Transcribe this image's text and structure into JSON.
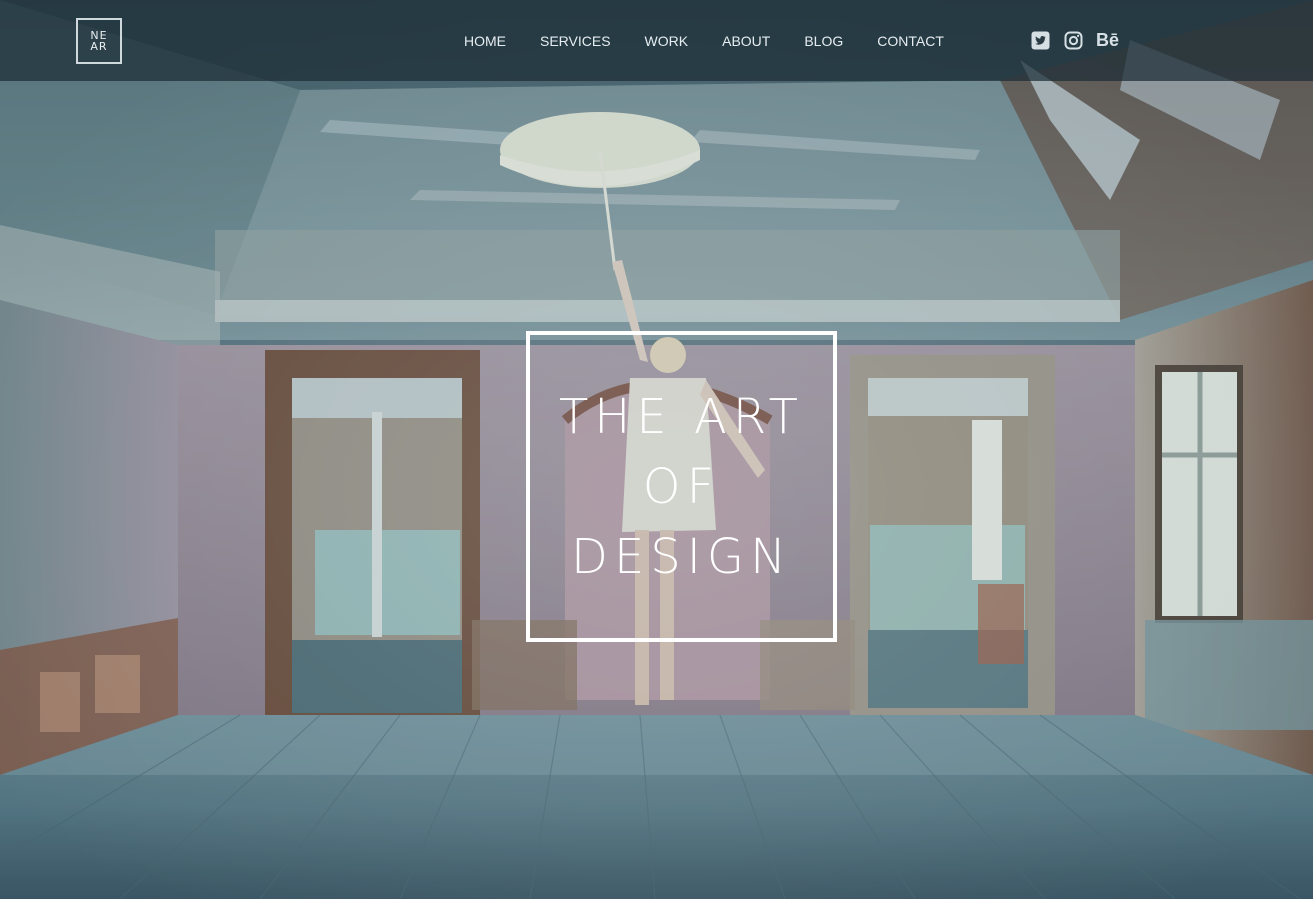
{
  "logo": {
    "line1": "NE",
    "line2": "AR"
  },
  "nav": {
    "items": [
      {
        "label": "HOME"
      },
      {
        "label": "SERVICES"
      },
      {
        "label": "WORK"
      },
      {
        "label": "ABOUT"
      },
      {
        "label": "BLOG"
      },
      {
        "label": "CONTACT"
      }
    ]
  },
  "social": {
    "icons": [
      "twitter-icon",
      "instagram-icon",
      "behance-icon"
    ],
    "behance_label": "Bē"
  },
  "hero": {
    "title_lines": [
      "THE ART",
      "OF",
      "DESIGN"
    ]
  },
  "colors": {
    "header_bg": "#1c2c36",
    "nav_text": "#e6edf0",
    "title_text": "#ffffff",
    "title_border": "#ffffff"
  }
}
